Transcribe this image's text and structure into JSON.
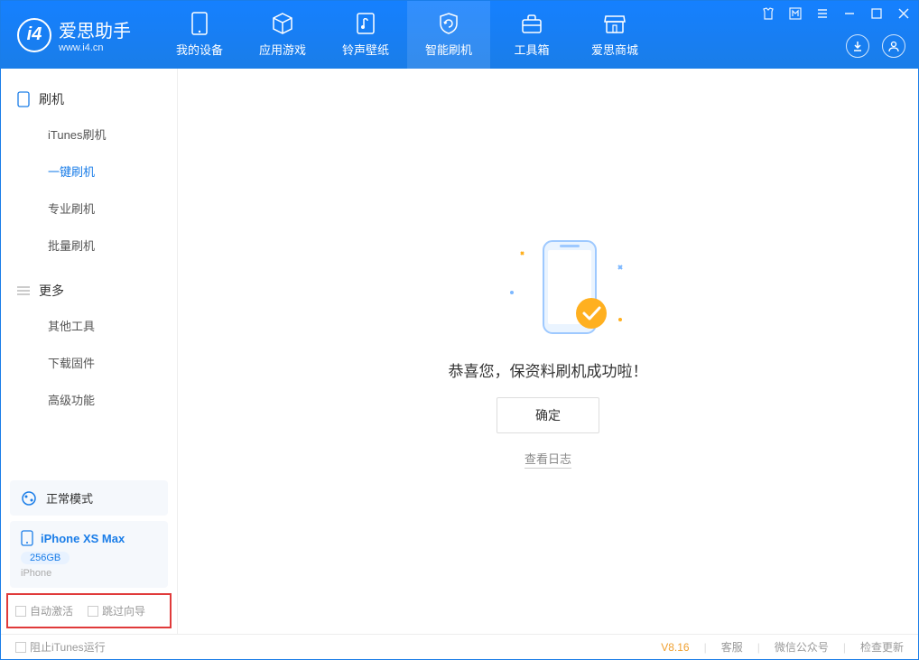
{
  "app": {
    "name": "爱思助手",
    "url": "www.i4.cn"
  },
  "tabs": [
    {
      "label": "我的设备"
    },
    {
      "label": "应用游戏"
    },
    {
      "label": "铃声壁纸"
    },
    {
      "label": "智能刷机"
    },
    {
      "label": "工具箱"
    },
    {
      "label": "爱思商城"
    }
  ],
  "sidebar": {
    "section1_title": "刷机",
    "items1": [
      "iTunes刷机",
      "一键刷机",
      "专业刷机",
      "批量刷机"
    ],
    "section2_title": "更多",
    "items2": [
      "其他工具",
      "下载固件",
      "高级功能"
    ]
  },
  "device": {
    "mode": "正常模式",
    "name": "iPhone XS Max",
    "storage": "256GB",
    "type": "iPhone"
  },
  "checkboxes": {
    "auto_activate": "自动激活",
    "skip_guide": "跳过向导"
  },
  "main": {
    "message": "恭喜您，保资料刷机成功啦！",
    "ok": "确定",
    "log": "查看日志"
  },
  "status": {
    "block_itunes": "阻止iTunes运行",
    "version": "V8.16",
    "support": "客服",
    "wechat": "微信公众号",
    "update": "检查更新"
  }
}
